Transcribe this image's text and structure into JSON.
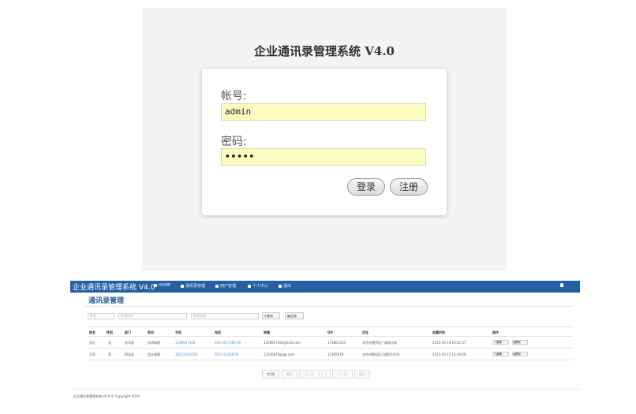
{
  "login": {
    "title": "企业通讯录管理系统 V4.0",
    "username_label": "帐号:",
    "username_value": "admin",
    "password_label": "密码:",
    "password_value": "•••••",
    "login_button": "登录",
    "register_button": "注册"
  },
  "app": {
    "brand": "企业通讯录管理系统 V4.0",
    "nav": [
      "HOME",
      "通讯录管理",
      "用户管理",
      "个人中心",
      "退出"
    ],
    "user": "admin",
    "page_title": "通讯录管理",
    "search": {
      "name_placeholder": "姓名",
      "start_placeholder": "开始时间",
      "end_placeholder": "结束时间",
      "query_button": "查询",
      "all_button": "全部"
    },
    "table": {
      "headers": [
        "姓名",
        "性别",
        "部门",
        "职位",
        "手机",
        "电话",
        "邮箱",
        "QQ",
        "住址",
        "创建时间",
        "操作"
      ],
      "rows": [
        [
          "孔红",
          "女",
          "技术部",
          "技术助理",
          "1358957444",
          "010-3917566-00",
          "1358957444@163.com",
          "175861344",
          "北京市望京区广顺南大街",
          "2015-10-19 10:52:37"
        ],
        [
          "王军",
          "男",
          "财务部",
          "会计管理",
          "13012345678",
          "010-12345678",
          "12345678@qq.com",
          "12345678",
          "北京市朝阳区大望桥102号",
          "2015-10-15 14:34:09"
        ]
      ],
      "edit_label": "编辑",
      "delete_label": "删除"
    },
    "pager": {
      "total": "共5条",
      "first": "首页",
      "prev": "上一页",
      "page": "1",
      "next": "下一页",
      "last": "尾页"
    },
    "footer": "企业通讯录管理系统 V4.0 © Copyright 2014"
  },
  "colors": {
    "navbar": "#2560a5",
    "input_fill": "#fafcc0",
    "link": "#4a90d0"
  }
}
